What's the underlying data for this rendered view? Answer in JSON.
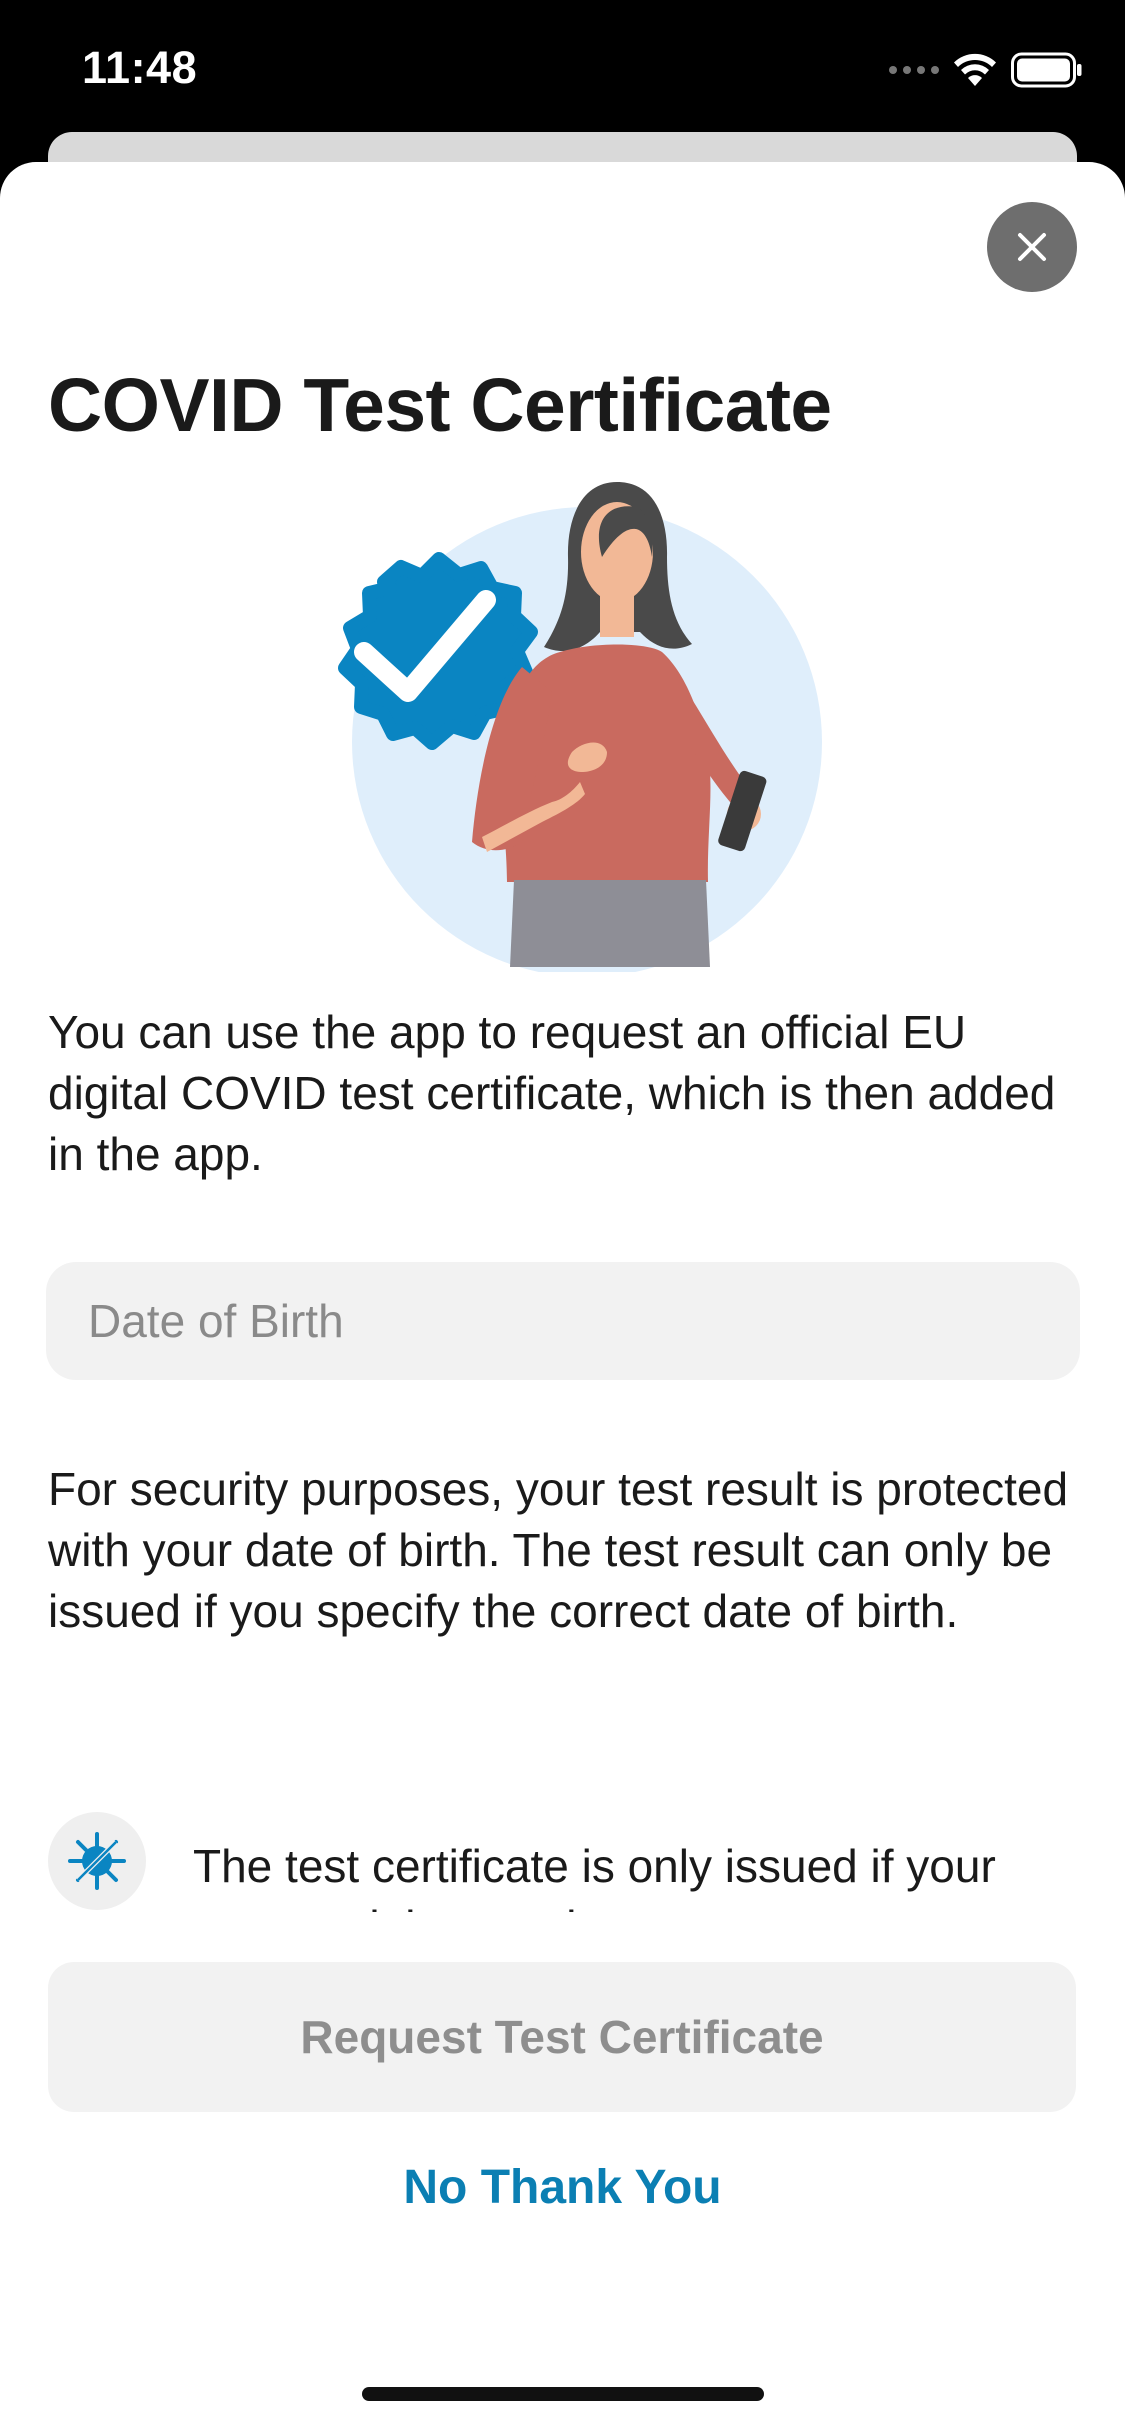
{
  "status_bar": {
    "time": "11:48"
  },
  "sheet": {
    "title": "COVID Test Certificate",
    "intro_text": "You can use the app to request an official EU digital COVID test certificate, which is then added in the app.",
    "dob_field": {
      "placeholder": "Date of Birth",
      "value": ""
    },
    "security_text": "For security purposes, your test result is protected with your date of birth. The test result can only be issued if you specify the correct date of birth.",
    "info_item": {
      "icon": "virus-icon",
      "text": "The test certificate is only issued if your test result is negative."
    },
    "primary_button_label": "Request Test Certificate",
    "secondary_button_label": "No Thank You"
  },
  "colors": {
    "accent": "#0B7FB3",
    "badge_blue": "#0A85C2",
    "illustration_circle": "#DFEEFB",
    "button_disabled_bg": "#F2F2F2",
    "button_disabled_text": "#8E8E8E"
  }
}
